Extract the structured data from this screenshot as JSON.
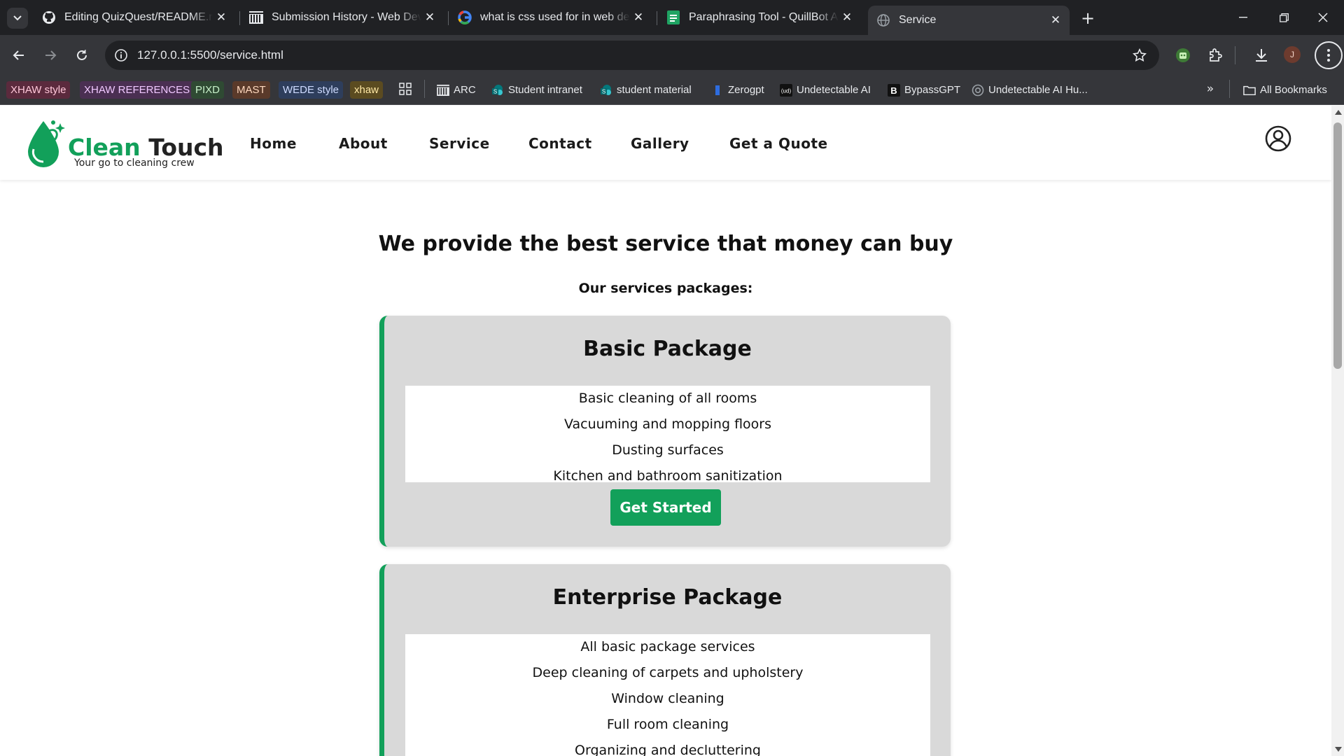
{
  "browser": {
    "tabs": [
      {
        "title": "Editing QuizQuest/README.md",
        "favicon": "github-icon"
      },
      {
        "title": "Submission History - Web Deve",
        "favicon": "arc-icon"
      },
      {
        "title": "what is css used for in web dev",
        "favicon": "google-icon"
      },
      {
        "title": "Paraphrasing Tool - QuillBot AI",
        "favicon": "quillbot-icon"
      },
      {
        "title": "Service",
        "favicon": "globe-icon",
        "active": true
      }
    ],
    "url": "127.0.0.1:5500/service.html",
    "profile_initial": "J",
    "bookmark_chips": [
      {
        "label": "XHAW style",
        "bg": "#5b2a3d",
        "fg": "#ffc7d9"
      },
      {
        "label": "XHAW REFERENCES",
        "bg": "#4a2f52",
        "fg": "#f0c8ff"
      },
      {
        "label": "PIXD",
        "bg": "#2f4a33",
        "fg": "#c7f0c9"
      },
      {
        "label": "MAST",
        "bg": "#5a3a2a",
        "fg": "#ffd9bf"
      },
      {
        "label": "WEDE style",
        "bg": "#2e3e5c",
        "fg": "#cfdcff"
      },
      {
        "label": "xhaw",
        "bg": "#5b4b20",
        "fg": "#ffe9a6"
      }
    ],
    "bookmarks": [
      {
        "label": "ARC",
        "icon": "arc-icon"
      },
      {
        "label": "Student intranet",
        "icon": "sharepoint-icon"
      },
      {
        "label": "student material",
        "icon": "sharepoint-icon"
      },
      {
        "label": "Zerogpt",
        "icon": "zerogpt-icon"
      },
      {
        "label": "Undetectable AI",
        "icon": "undetectable-icon"
      },
      {
        "label": "BypassGPT",
        "icon": "bypassgpt-icon"
      },
      {
        "label": "Undetectable AI Hu...",
        "icon": "openai-icon"
      }
    ],
    "all_bookmarks_label": "All Bookmarks"
  },
  "site": {
    "brand_part1": "Clean",
    "brand_part2": "Touch",
    "tagline": "Your go to cleaning crew",
    "nav": [
      "Home",
      "About",
      "Service",
      "Contact",
      "Gallery",
      "Get a Quote"
    ],
    "accent_color": "#12a05a"
  },
  "main": {
    "title": "We provide the best service that money can buy",
    "subtitle": "Our services packages:",
    "packages": [
      {
        "name": "Basic Package",
        "features": [
          "Basic cleaning of all rooms",
          "Vacuuming and mopping floors",
          "Dusting surfaces",
          "Kitchen and bathroom sanitization"
        ],
        "button": "Get Started"
      },
      {
        "name": "Enterprise Package",
        "features": [
          "All basic package services",
          "Deep cleaning of carpets and upholstery",
          "Window cleaning",
          "Full room cleaning",
          "Organizing and decluttering"
        ]
      }
    ]
  }
}
